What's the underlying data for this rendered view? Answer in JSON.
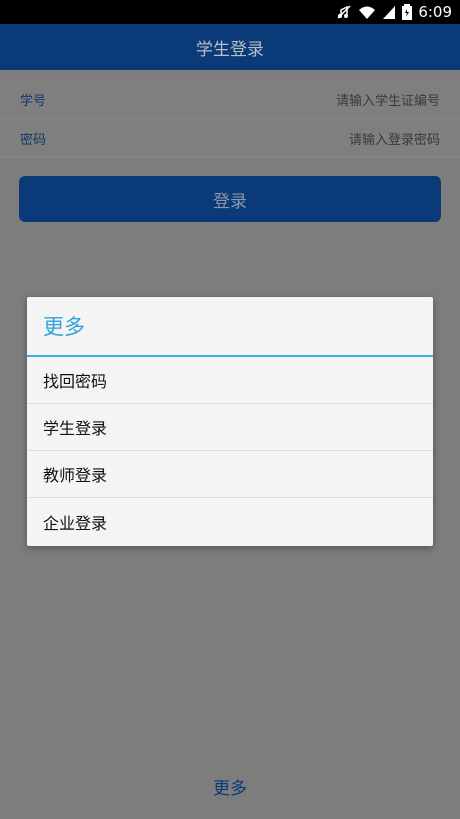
{
  "status_bar": {
    "time": "6:09",
    "icons": [
      "mute-icon",
      "wifi-icon",
      "signal-icon",
      "battery-icon"
    ]
  },
  "app_bar": {
    "title": "学生登录"
  },
  "form": {
    "student_id": {
      "label": "学号",
      "placeholder": "请输入学生证编号"
    },
    "password": {
      "label": "密码",
      "placeholder": "请输入登录密码"
    }
  },
  "login_button": "登录",
  "more_link": "更多",
  "dialog": {
    "title": "更多",
    "items": [
      {
        "label": "找回密码"
      },
      {
        "label": "学生登录"
      },
      {
        "label": "教师登录"
      },
      {
        "label": "企业登录"
      }
    ]
  },
  "colors": {
    "primary": "#0a3a78",
    "accent": "#35b4e8",
    "scrim": "#7d7d7d"
  }
}
